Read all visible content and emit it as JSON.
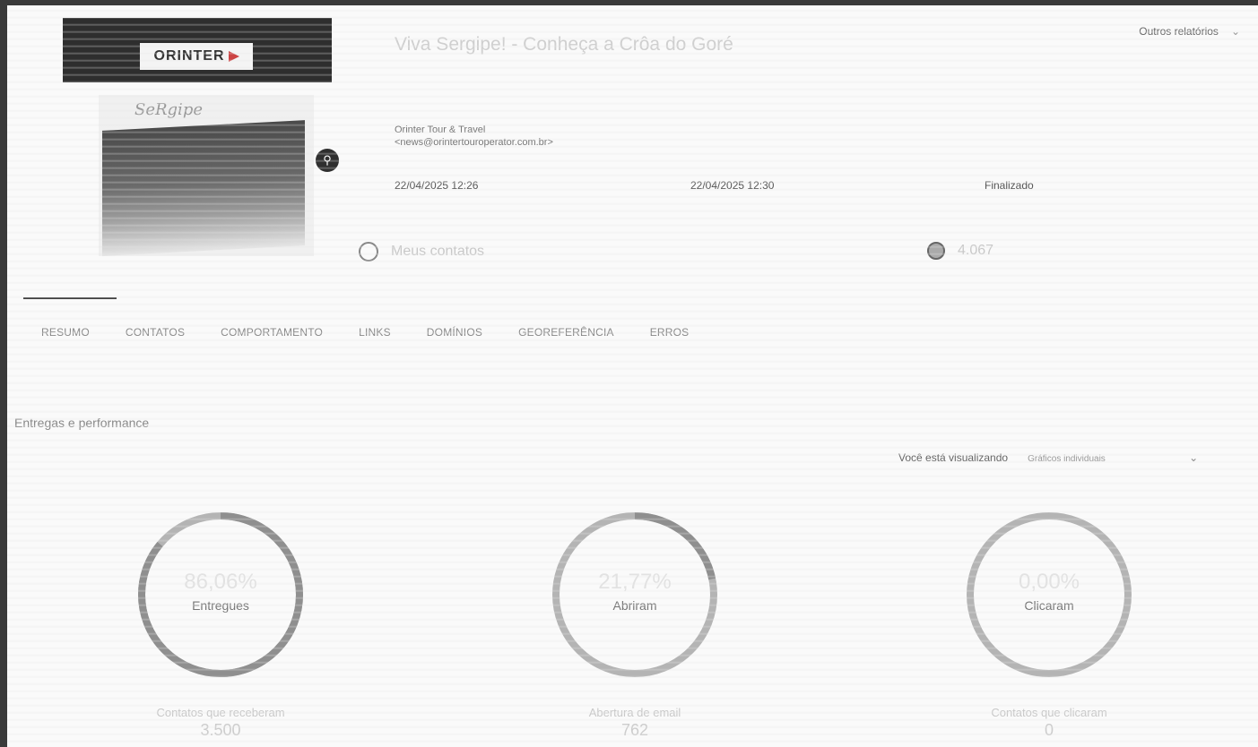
{
  "header": {
    "other_reports": "Outros relatórios",
    "campaign_title": "Viva Sergipe! - Conheça a Crôa do Goré",
    "sender_name": "Orinter Tour & Travel",
    "sender_email": "<news@orintertouroperator.com.br>",
    "created_at": "22/04/2025 12:26",
    "sent_at": "22/04/2025 12:30",
    "status": "Finalizado",
    "list_name": "Meus contatos",
    "contacts_count": "4.067"
  },
  "thumbnail": {
    "brand": "ORINTER",
    "script_text": "SeRgipe"
  },
  "tabs": [
    {
      "label": "RESUMO",
      "active": true
    },
    {
      "label": "CONTATOS"
    },
    {
      "label": "COMPORTAMENTO"
    },
    {
      "label": "LINKS"
    },
    {
      "label": "DOMÍNIOS"
    },
    {
      "label": "GEOREFERÊNCIA"
    },
    {
      "label": "ERROS"
    }
  ],
  "section": {
    "title": "Entregas e performance",
    "viewing_label": "Você está visualizando",
    "viewing_value": "Gráficos individuais"
  },
  "gauges": [
    {
      "percent_text": "86,06%",
      "fraction": 0.8606,
      "label": "Entregues",
      "metric_label": "Contatos que receberam",
      "metric_value": "3.500"
    },
    {
      "percent_text": "21,77%",
      "fraction": 0.2177,
      "label": "Abriram",
      "metric_label": "Abertura de email",
      "metric_value": "762"
    },
    {
      "percent_text": "0,00%",
      "fraction": 0.0,
      "label": "Clicaram",
      "metric_label": "Contatos que clicaram",
      "metric_value": "0"
    }
  ],
  "colors": {
    "arc_track": "#b4b4b4",
    "arc_fill": "#8f8f8f"
  }
}
